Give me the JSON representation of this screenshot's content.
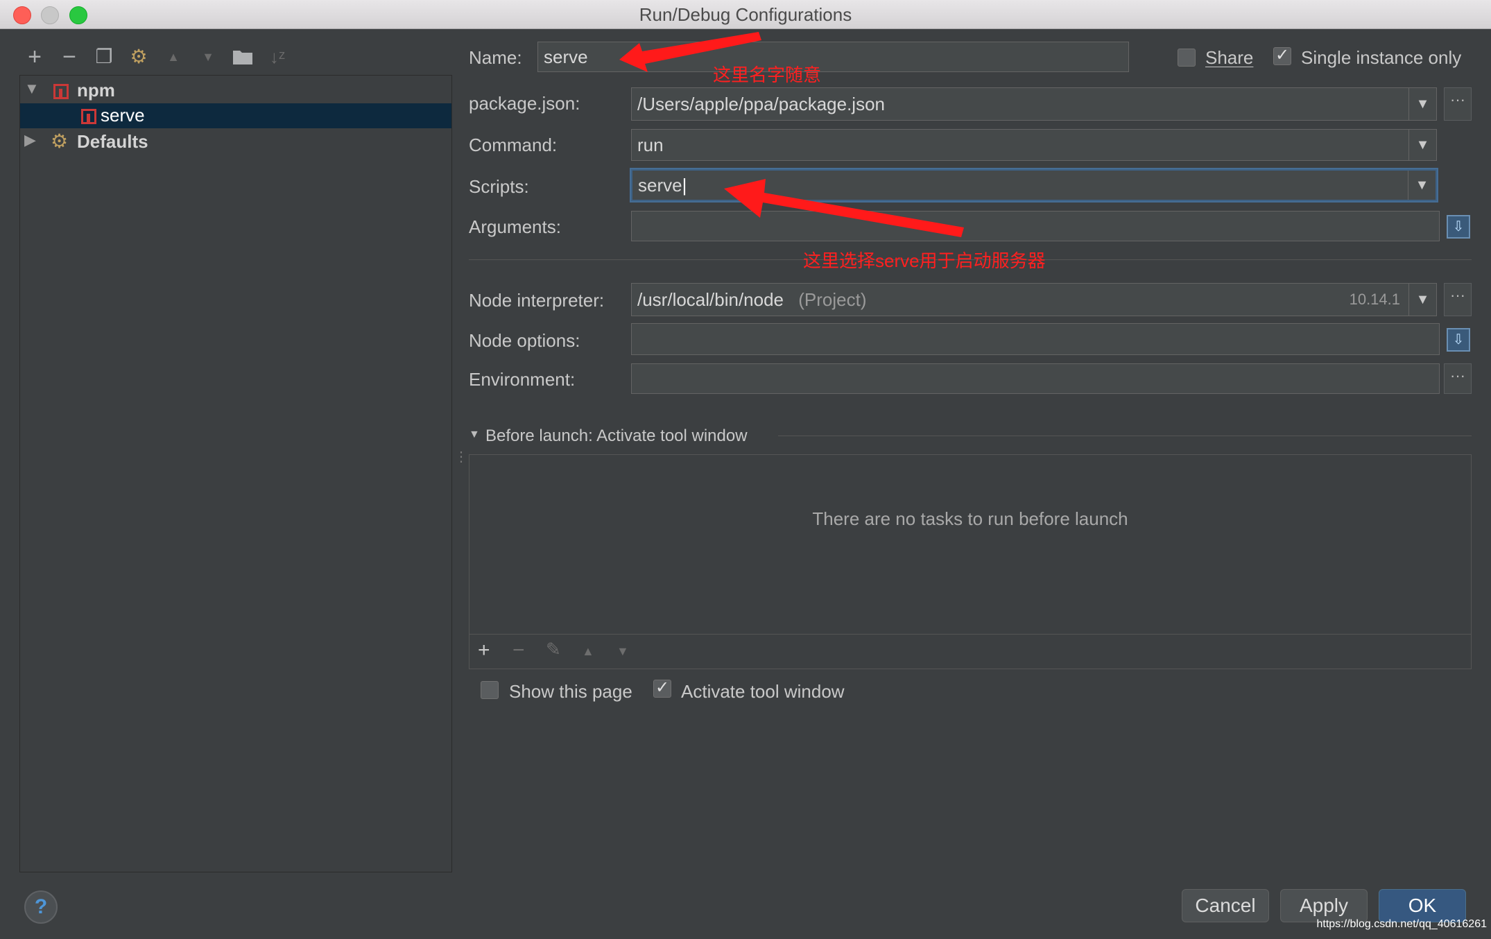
{
  "window": {
    "title": "Run/Debug Configurations"
  },
  "toolbar": {
    "icons": [
      "add-icon",
      "remove-icon",
      "copy-icon",
      "wrench-icon",
      "move-up-icon",
      "move-down-icon",
      "folder-icon",
      "sort-icon"
    ],
    "glyphs": [
      "+",
      "−",
      "❐",
      "⚙",
      "▲",
      "▼",
      "▬",
      "↓"
    ]
  },
  "tree": {
    "items": [
      {
        "label": "npm",
        "expanded": true,
        "icon": "npm-icon"
      },
      {
        "label": "serve",
        "selected": true,
        "icon": "npm-icon"
      },
      {
        "label": "Defaults",
        "expanded": false,
        "icon": "wrench-icon"
      }
    ]
  },
  "form": {
    "name_label": "Name:",
    "name_value": "serve",
    "share_label": "Share",
    "share_checked": false,
    "single_instance_label": "Single instance only",
    "single_instance_checked": true,
    "package_label": "package.json:",
    "package_value": "/Users/apple/ppa/package.json",
    "command_label": "Command:",
    "command_value": "run",
    "scripts_label": "Scripts:",
    "scripts_value": "serve",
    "arguments_label": "Arguments:",
    "arguments_value": "",
    "node_interpreter_label": "Node interpreter:",
    "node_interpreter_value": "/usr/local/bin/node",
    "node_interpreter_hint": "(Project)",
    "node_version": "10.14.1",
    "node_options_label": "Node options:",
    "node_options_value": "",
    "environment_label": "Environment:",
    "environment_value": ""
  },
  "before_launch": {
    "title": "Before launch: Activate tool window",
    "empty_text": "There are no tasks to run before launch",
    "show_page_label": "Show this page",
    "show_page_checked": false,
    "activate_label": "Activate tool window",
    "activate_checked": true
  },
  "annotations": {
    "name_note": "这里名字随意",
    "scripts_note": "这里选择serve用于启动服务器",
    "color": "#ff2020"
  },
  "buttons": {
    "cancel": "Cancel",
    "apply": "Apply",
    "ok": "OK",
    "help": "?"
  },
  "watermark": "https://blog.csdn.net/qq_40616261"
}
